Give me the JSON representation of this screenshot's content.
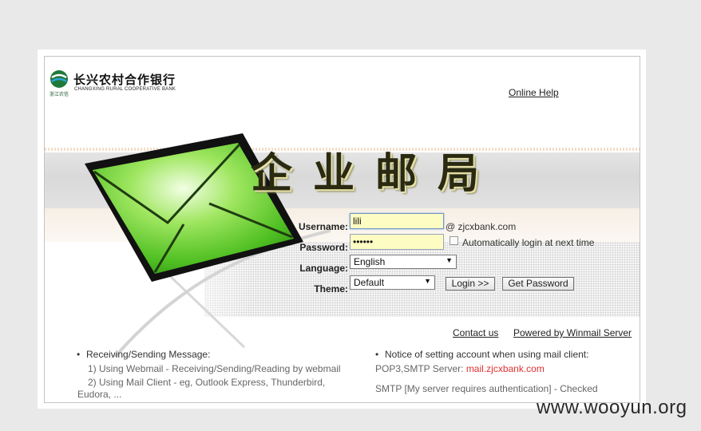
{
  "header": {
    "logo_badge_text": "浙江农信",
    "bank_name_cn": "长兴农村合作银行",
    "bank_name_en": "CHANGXING RURAL COOPERATIVE BANK",
    "online_help": "Online Help"
  },
  "banner": {
    "title": "企业邮局"
  },
  "login": {
    "username_label": "Username:",
    "username_value": "lili",
    "domain": "@ zjcxbank.com",
    "password_label": "Password:",
    "password_value": "••••••",
    "auto_login_label": "Automatically login at next time",
    "auto_login_checked": false,
    "language_label": "Language:",
    "language_value": "English",
    "theme_label": "Theme:",
    "theme_value": "Default",
    "login_button": "Login >>",
    "get_password_button": "Get Password"
  },
  "footer": {
    "contact_us": "Contact us",
    "powered_by": "Powered by Winmail Server",
    "left": {
      "title": "Receiving/Sending Message:",
      "line1": "1) Using Webmail - Receiving/Sending/Reading by webmail",
      "line2": "2) Using Mail Client - eg, Outlook Express, Thunderbird,",
      "line3": "Eudora, ..."
    },
    "right": {
      "title": "Notice of setting account when using mail client:",
      "server_prefix": "POP3,SMTP Server: ",
      "server_name": "mail.zjcxbank.com",
      "smtp_note": "SMTP [My server requires authentication] - Checked"
    }
  },
  "watermark": "www.wooyun.org",
  "colors": {
    "input_bg": "#fdfcc2",
    "envelope_green": "#6fcf3a",
    "server_link": "#e03030"
  }
}
